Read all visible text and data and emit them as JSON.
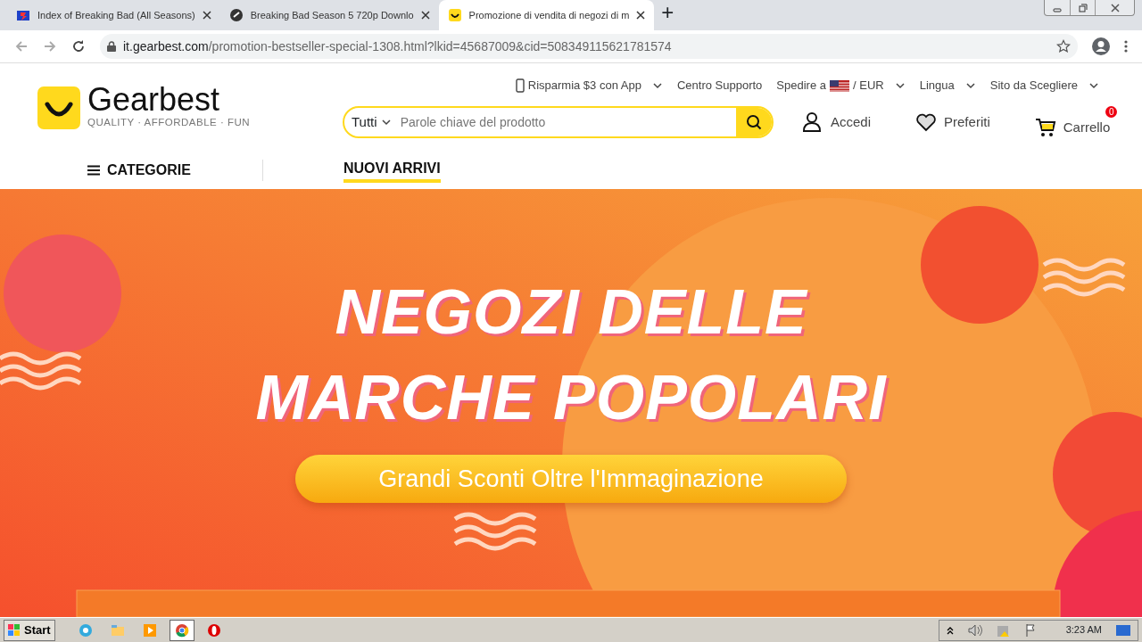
{
  "browser": {
    "tabs": [
      {
        "title": "Index of Breaking Bad (All Seasons)",
        "kind": "tv",
        "selected": false
      },
      {
        "title": "Breaking Bad Season 5 720p Downlo",
        "kind": "shield",
        "selected": false
      },
      {
        "title": "Promozione di vendita di negozi di m",
        "kind": "smile",
        "selected": true
      }
    ],
    "new_tab": "+",
    "address": {
      "host": "it.gearbest.com",
      "path": "/promotion-bestseller-special-1308.html?lkid=45687009&cid=508349115621781574"
    }
  },
  "header": {
    "logo": {
      "name": "Gearbest",
      "tagline": "QUALITY · AFFORDABLE · FUN"
    },
    "top_links": [
      {
        "label": "Risparmia $3 con App",
        "kind": "phone",
        "dropdown": true
      },
      {
        "label": "Centro Supporto",
        "kind": "plain",
        "dropdown": false
      },
      {
        "label": "Spedire a",
        "suffix": "/ EUR",
        "kind": "flag",
        "dropdown": true
      },
      {
        "label": "Lingua",
        "kind": "plain",
        "dropdown": true
      },
      {
        "label": "Sito da Scegliere",
        "kind": "plain",
        "dropdown": true
      }
    ],
    "search": {
      "category": "Tutti",
      "placeholder": "Parole chiave del prodotto"
    },
    "actions": [
      {
        "label": "Accedi",
        "kind": "user"
      },
      {
        "label": "Preferiti",
        "kind": "heart"
      },
      {
        "label": "Carrello",
        "kind": "cart",
        "badge": "0"
      }
    ],
    "nav": [
      {
        "label": "CATEGORIE",
        "kind": "menu",
        "selected": false
      },
      {
        "label": "NUOVI ARRIVI",
        "kind": "plain",
        "selected": true
      }
    ]
  },
  "banner": {
    "title_lines": [
      "NEGOZI DELLE",
      "MARCHE POPOLARI"
    ],
    "button": "Grandi Sconti Oltre l'Immaginazione"
  },
  "taskbar": {
    "start": "Start",
    "apps": [
      {
        "kind": "ie",
        "selected": false
      },
      {
        "kind": "folder",
        "selected": false
      },
      {
        "kind": "media",
        "selected": false
      },
      {
        "kind": "chrome",
        "selected": true
      },
      {
        "kind": "opera",
        "selected": false
      }
    ],
    "clock": "3:23 AM"
  }
}
